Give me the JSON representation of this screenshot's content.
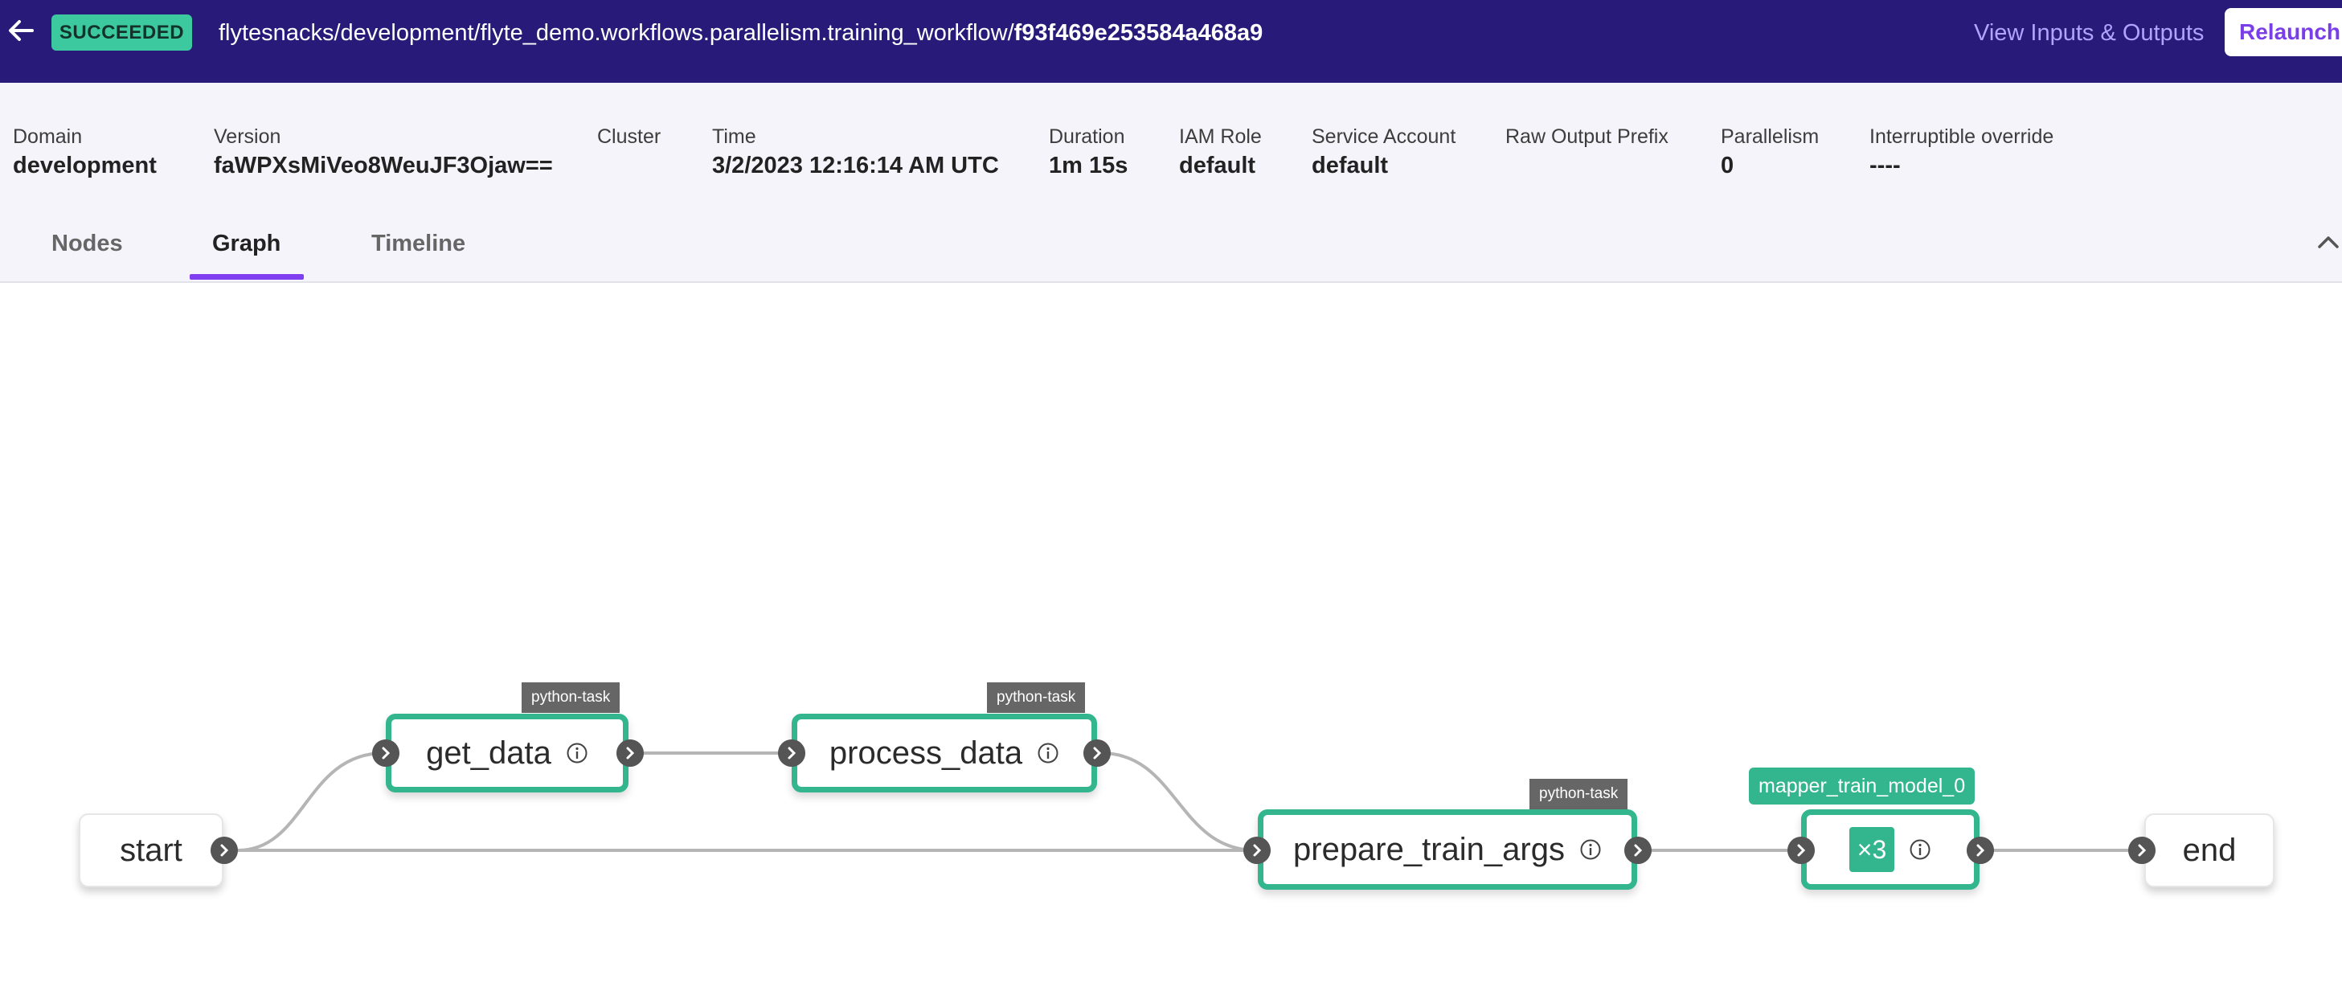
{
  "header": {
    "status": "SUCCEEDED",
    "breadcrumb_prefix": "flytesnacks/development/flyte_demo.workflows.parallelism.training_workflow/",
    "execution_id": "f93f469e253584a468a9",
    "view_io_label": "View Inputs & Outputs",
    "relaunch_label": "Relaunch",
    "colors": {
      "bar": "#271a78",
      "status": "#3dc9a0",
      "accent": "#7f3ff0"
    }
  },
  "meta": {
    "domain": {
      "label": "Domain",
      "value": "development"
    },
    "version": {
      "label": "Version",
      "value": "faWPXsMiVeo8WeuJF3Ojaw=="
    },
    "cluster": {
      "label": "Cluster",
      "value": ""
    },
    "time": {
      "label": "Time",
      "value": "3/2/2023 12:16:14 AM UTC"
    },
    "duration": {
      "label": "Duration",
      "value": "1m 15s"
    },
    "iam_role": {
      "label": "IAM Role",
      "value": "default"
    },
    "service_account": {
      "label": "Service Account",
      "value": "default"
    },
    "raw_output_prefix": {
      "label": "Raw Output Prefix",
      "value": ""
    },
    "parallelism": {
      "label": "Parallelism",
      "value": "0"
    },
    "interruptible": {
      "label": "Interruptible override",
      "value": "----"
    }
  },
  "tabs": [
    {
      "label": "Nodes",
      "active": false
    },
    {
      "label": "Graph",
      "active": true
    },
    {
      "label": "Timeline",
      "active": false
    }
  ],
  "graph": {
    "nodes": {
      "start": {
        "label": "start"
      },
      "get_data": {
        "label": "get_data",
        "type": "python-task"
      },
      "process_data": {
        "label": "process_data",
        "type": "python-task"
      },
      "prepare_train_args": {
        "label": "prepare_train_args",
        "type": "python-task"
      },
      "mapper": {
        "label": "mapper_train_model_0",
        "count": "×3"
      },
      "end": {
        "label": "end"
      }
    },
    "success_color": "#33b68d"
  }
}
